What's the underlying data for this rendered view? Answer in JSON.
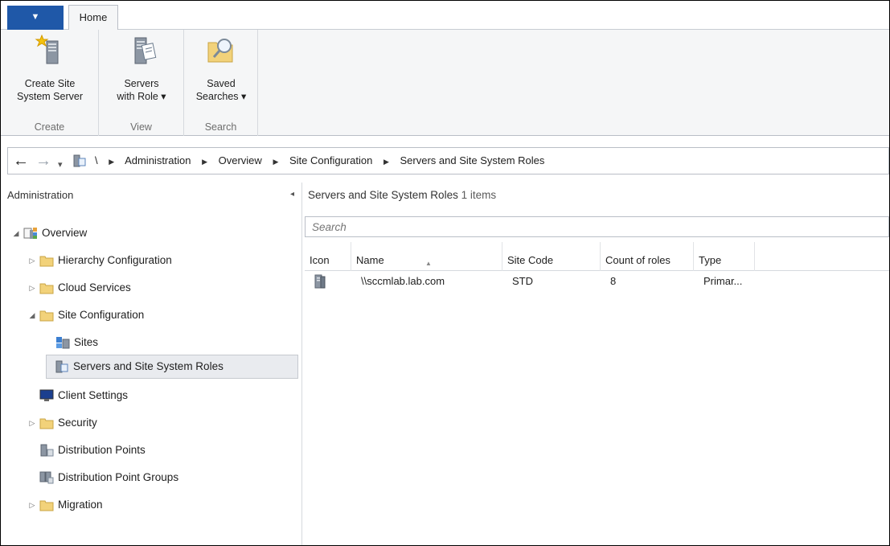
{
  "ribbon": {
    "app_menu_glyph": "▼",
    "tab_home": "Home",
    "groups": [
      {
        "label": "Create",
        "button": {
          "line1": "Create Site",
          "line2": "System Server",
          "icon": "create-server-icon"
        }
      },
      {
        "label": "View",
        "button": {
          "line1": "Servers",
          "line2": "with Role ▾",
          "icon": "servers-role-icon"
        }
      },
      {
        "label": "Search",
        "button": {
          "line1": "Saved",
          "line2": "Searches ▾",
          "icon": "saved-search-icon"
        }
      }
    ]
  },
  "address": {
    "back": "←",
    "forward": "→",
    "dropdown": "▾",
    "root": "\\",
    "crumbs": [
      "Administration",
      "Overview",
      "Site Configuration",
      "Servers and Site System Roles"
    ]
  },
  "nav": {
    "title": "Administration",
    "collapse_glyph": "◂",
    "items": [
      {
        "label": "Overview",
        "icon": "overview-icon"
      },
      {
        "label": "Hierarchy Configuration",
        "icon": "folder-icon"
      },
      {
        "label": "Cloud Services",
        "icon": "folder-icon"
      },
      {
        "label": "Site Configuration",
        "icon": "folder-icon"
      },
      {
        "label": "Sites",
        "icon": "sites-icon"
      },
      {
        "label": "Servers and Site System Roles",
        "icon": "server-roles-icon"
      },
      {
        "label": "Client Settings",
        "icon": "client-settings-icon"
      },
      {
        "label": "Security",
        "icon": "folder-icon"
      },
      {
        "label": "Distribution Points",
        "icon": "distribution-point-icon"
      },
      {
        "label": "Distribution Point Groups",
        "icon": "distribution-group-icon"
      },
      {
        "label": "Migration",
        "icon": "folder-icon"
      }
    ]
  },
  "content": {
    "title": "Servers and Site System Roles",
    "count": "1 items",
    "search_placeholder": "Search",
    "columns": [
      "Icon",
      "Name",
      "Site Code",
      "Count of roles",
      "Type"
    ],
    "rows": [
      {
        "name": "\\\\sccmlab.lab.com",
        "site_code": "STD",
        "count_of_roles": "8",
        "type": "Primar..."
      }
    ]
  },
  "colors": {
    "accent": "#1f58a8",
    "folder": "#f2d27a",
    "selection": "#e9ebef"
  }
}
